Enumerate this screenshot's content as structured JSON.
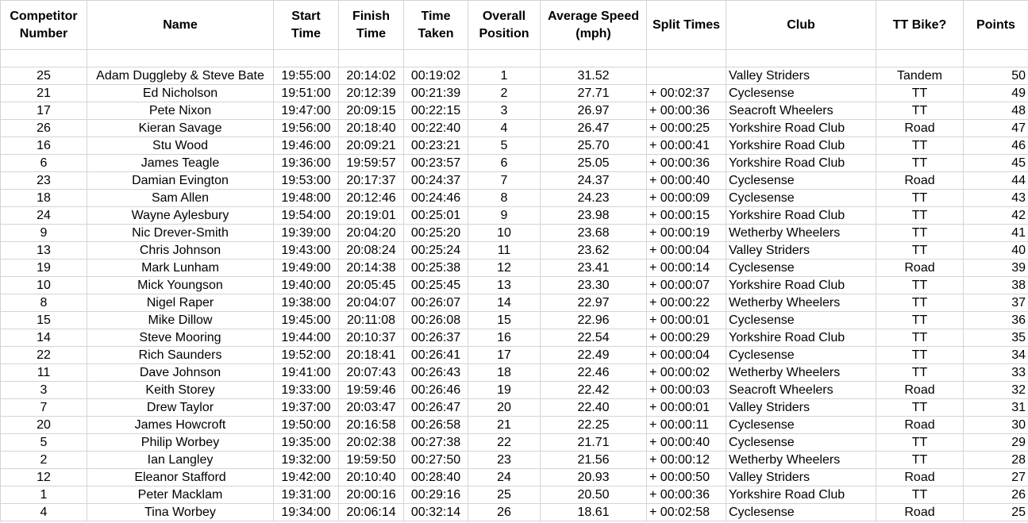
{
  "headers": [
    "Competitor Number",
    "Name",
    "Start Time",
    "Finish Time",
    "Time Taken",
    "Overall Position",
    "Average Speed (mph)",
    "Split Times",
    "Club",
    "TT Bike?",
    "Points"
  ],
  "rows": [
    [
      "25",
      "Adam Duggleby & Steve Bate",
      "19:55:00",
      "20:14:02",
      "00:19:02",
      "1",
      "31.52",
      "",
      "Valley Striders",
      "Tandem",
      "50"
    ],
    [
      "21",
      "Ed Nicholson",
      "19:51:00",
      "20:12:39",
      "00:21:39",
      "2",
      "27.71",
      "+ 00:02:37",
      "Cyclesense",
      "TT",
      "49"
    ],
    [
      "17",
      "Pete Nixon",
      "19:47:00",
      "20:09:15",
      "00:22:15",
      "3",
      "26.97",
      "+ 00:00:36",
      "Seacroft Wheelers",
      "TT",
      "48"
    ],
    [
      "26",
      "Kieran Savage",
      "19:56:00",
      "20:18:40",
      "00:22:40",
      "4",
      "26.47",
      "+ 00:00:25",
      "Yorkshire Road Club",
      "Road",
      "47"
    ],
    [
      "16",
      "Stu Wood",
      "19:46:00",
      "20:09:21",
      "00:23:21",
      "5",
      "25.70",
      "+ 00:00:41",
      "Yorkshire Road Club",
      "TT",
      "46"
    ],
    [
      "6",
      "James Teagle",
      "19:36:00",
      "19:59:57",
      "00:23:57",
      "6",
      "25.05",
      "+ 00:00:36",
      "Yorkshire Road Club",
      "TT",
      "45"
    ],
    [
      "23",
      "Damian Evington",
      "19:53:00",
      "20:17:37",
      "00:24:37",
      "7",
      "24.37",
      "+ 00:00:40",
      "Cyclesense",
      "Road",
      "44"
    ],
    [
      "18",
      "Sam Allen",
      "19:48:00",
      "20:12:46",
      "00:24:46",
      "8",
      "24.23",
      "+ 00:00:09",
      "Cyclesense",
      "TT",
      "43"
    ],
    [
      "24",
      "Wayne Aylesbury",
      "19:54:00",
      "20:19:01",
      "00:25:01",
      "9",
      "23.98",
      "+ 00:00:15",
      "Yorkshire Road Club",
      "TT",
      "42"
    ],
    [
      "9",
      "Nic Drever-Smith",
      "19:39:00",
      "20:04:20",
      "00:25:20",
      "10",
      "23.68",
      "+ 00:00:19",
      "Wetherby Wheelers",
      "TT",
      "41"
    ],
    [
      "13",
      "Chris Johnson",
      "19:43:00",
      "20:08:24",
      "00:25:24",
      "11",
      "23.62",
      "+ 00:00:04",
      "Valley Striders",
      "TT",
      "40"
    ],
    [
      "19",
      "Mark Lunham",
      "19:49:00",
      "20:14:38",
      "00:25:38",
      "12",
      "23.41",
      "+ 00:00:14",
      "Cyclesense",
      "Road",
      "39"
    ],
    [
      "10",
      "Mick Youngson",
      "19:40:00",
      "20:05:45",
      "00:25:45",
      "13",
      "23.30",
      "+ 00:00:07",
      "Yorkshire Road Club",
      "TT",
      "38"
    ],
    [
      "8",
      "Nigel Raper",
      "19:38:00",
      "20:04:07",
      "00:26:07",
      "14",
      "22.97",
      "+ 00:00:22",
      "Wetherby Wheelers",
      "TT",
      "37"
    ],
    [
      "15",
      "Mike Dillow",
      "19:45:00",
      "20:11:08",
      "00:26:08",
      "15",
      "22.96",
      "+ 00:00:01",
      "Cyclesense",
      "TT",
      "36"
    ],
    [
      "14",
      "Steve Mooring",
      "19:44:00",
      "20:10:37",
      "00:26:37",
      "16",
      "22.54",
      "+ 00:00:29",
      "Yorkshire Road Club",
      "TT",
      "35"
    ],
    [
      "22",
      "Rich Saunders",
      "19:52:00",
      "20:18:41",
      "00:26:41",
      "17",
      "22.49",
      "+ 00:00:04",
      "Cyclesense",
      "TT",
      "34"
    ],
    [
      "11",
      "Dave Johnson",
      "19:41:00",
      "20:07:43",
      "00:26:43",
      "18",
      "22.46",
      "+ 00:00:02",
      "Wetherby Wheelers",
      "TT",
      "33"
    ],
    [
      "3",
      "Keith Storey",
      "19:33:00",
      "19:59:46",
      "00:26:46",
      "19",
      "22.42",
      "+ 00:00:03",
      "Seacroft Wheelers",
      "Road",
      "32"
    ],
    [
      "7",
      "Drew Taylor",
      "19:37:00",
      "20:03:47",
      "00:26:47",
      "20",
      "22.40",
      "+ 00:00:01",
      "Valley Striders",
      "TT",
      "31"
    ],
    [
      "20",
      "James Howcroft",
      "19:50:00",
      "20:16:58",
      "00:26:58",
      "21",
      "22.25",
      "+ 00:00:11",
      "Cyclesense",
      "Road",
      "30"
    ],
    [
      "5",
      "Philip Worbey",
      "19:35:00",
      "20:02:38",
      "00:27:38",
      "22",
      "21.71",
      "+ 00:00:40",
      "Cyclesense",
      "TT",
      "29"
    ],
    [
      "2",
      "Ian Langley",
      "19:32:00",
      "19:59:50",
      "00:27:50",
      "23",
      "21.56",
      "+ 00:00:12",
      "Wetherby Wheelers",
      "TT",
      "28"
    ],
    [
      "12",
      "Eleanor Stafford",
      "19:42:00",
      "20:10:40",
      "00:28:40",
      "24",
      "20.93",
      "+ 00:00:50",
      "Valley Striders",
      "Road",
      "27"
    ],
    [
      "1",
      "Peter Macklam",
      "19:31:00",
      "20:00:16",
      "00:29:16",
      "25",
      "20.50",
      "+ 00:00:36",
      "Yorkshire Road Club",
      "TT",
      "26"
    ],
    [
      "4",
      "Tina Worbey",
      "19:34:00",
      "20:06:14",
      "00:32:14",
      "26",
      "18.61",
      "+ 00:02:58",
      "Cyclesense",
      "Road",
      "25"
    ]
  ]
}
